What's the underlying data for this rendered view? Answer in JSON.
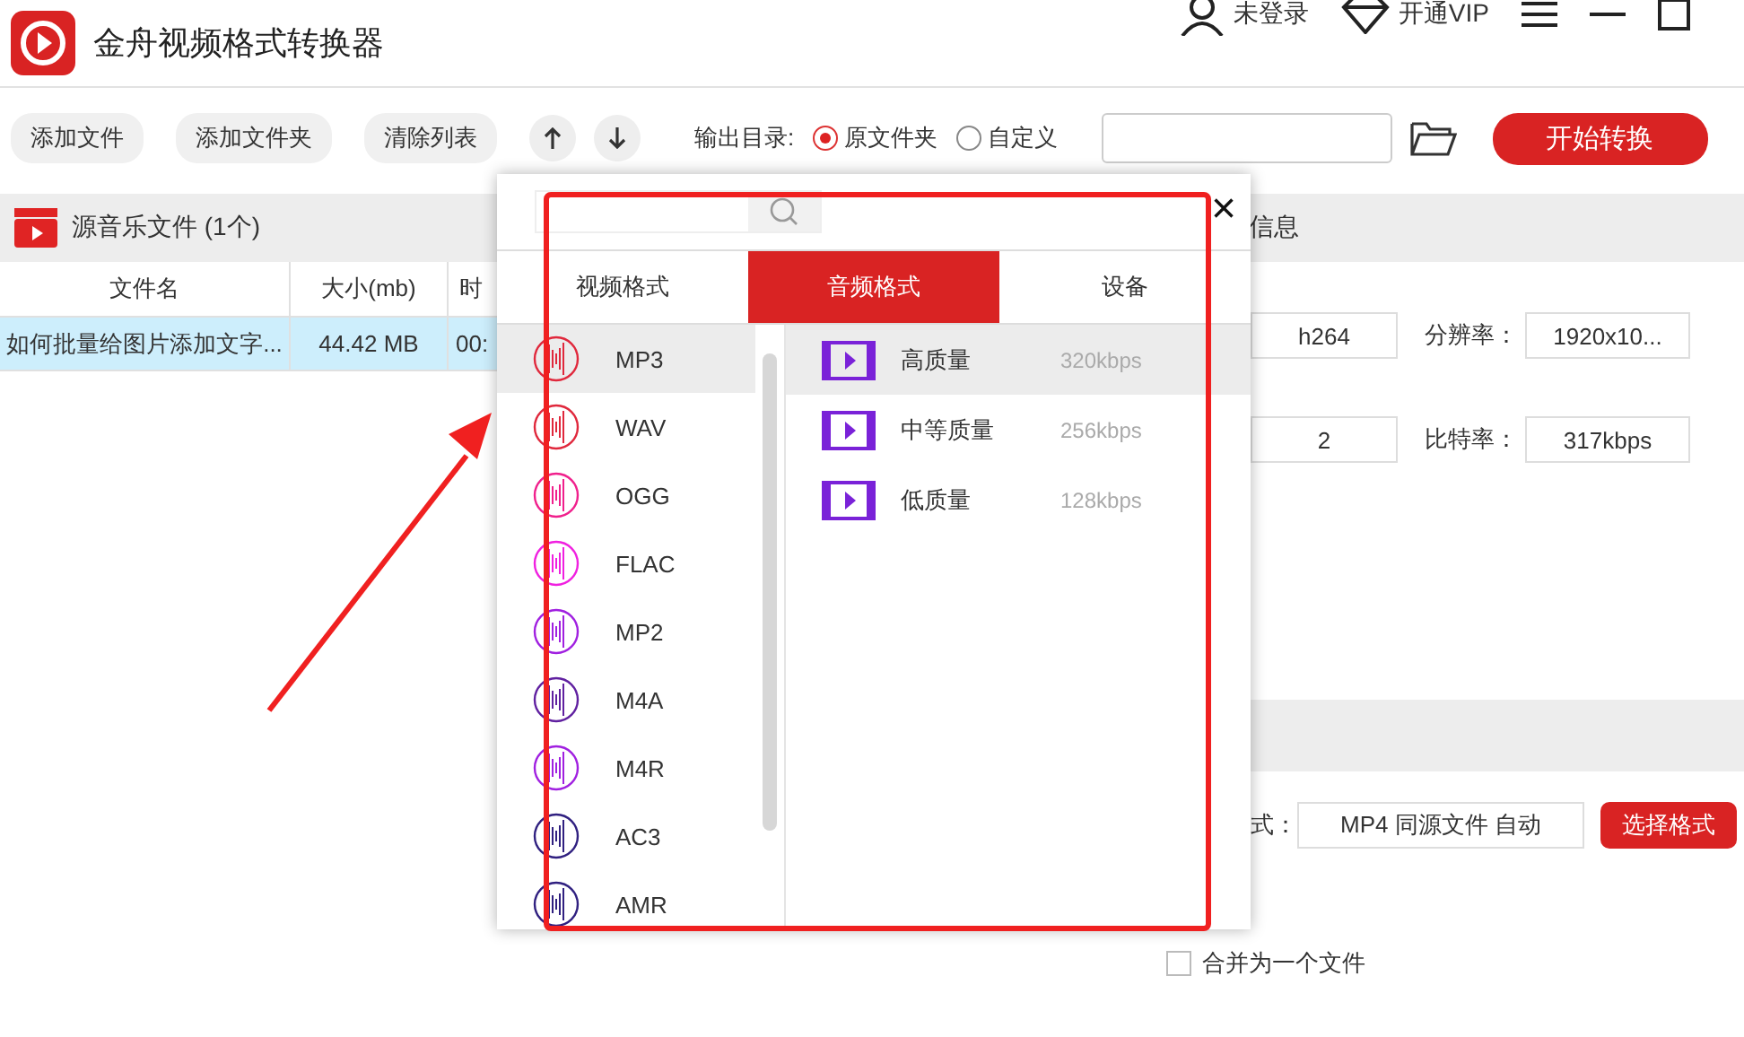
{
  "window": {
    "title": "金舟视频格式转换器",
    "user": "未登录",
    "vip": "开通VIP"
  },
  "toolbar": {
    "buttons": [
      "添加文件",
      "添加文件夹",
      "清除列表"
    ],
    "output_label": "输出目录:",
    "options": [
      {
        "label": "原文件夹",
        "selected": true
      },
      {
        "label": "自定义",
        "selected": false
      }
    ],
    "start": "开始转换"
  },
  "source": {
    "title": "源音乐文件 (1个)",
    "columns": [
      "文件名",
      "大小(mb)",
      "时"
    ],
    "rows": [
      {
        "cells": [
          "如何批量给图片添加文字...",
          "44.42 MB",
          "00:"
        ],
        "selected": true
      }
    ]
  },
  "info": {
    "title": "信息",
    "fields": [
      {
        "value": "h264",
        "label": "分辨率：",
        "value2": "1920x10..."
      },
      {
        "value": "2",
        "label": "比特率：",
        "value2": "317kbps"
      }
    ]
  },
  "output": {
    "label": "式：",
    "value": "MP4 同源文件 自动",
    "button": "选择格式",
    "merge": {
      "label": "合并为一个文件",
      "checked": false
    }
  },
  "popup": {
    "close": "×",
    "tabs": [
      {
        "label": "视频格式",
        "selected": false
      },
      {
        "label": "音频格式",
        "selected": true
      },
      {
        "label": "设备",
        "selected": false
      }
    ],
    "formats": [
      {
        "name": "MP3",
        "color": "#e0283c",
        "selected": true
      },
      {
        "name": "WAV",
        "color": "#e0283c",
        "selected": false
      },
      {
        "name": "OGG",
        "color": "#f0208c",
        "selected": false
      },
      {
        "name": "FLAC",
        "color": "#f020e0",
        "selected": false
      },
      {
        "name": "MP2",
        "color": "#a020e0",
        "selected": false
      },
      {
        "name": "M4A",
        "color": "#6020a0",
        "selected": false
      },
      {
        "name": "M4R",
        "color": "#a020e0",
        "selected": false
      },
      {
        "name": "AC3",
        "color": "#302080",
        "selected": false
      },
      {
        "name": "AMR",
        "color": "#302080",
        "selected": false
      }
    ],
    "qualities": [
      {
        "name": "高质量",
        "bitrate": "320kbps",
        "selected": true
      },
      {
        "name": "中等质量",
        "bitrate": "256kbps",
        "selected": false
      },
      {
        "name": "低质量",
        "bitrate": "128kbps",
        "selected": false
      }
    ]
  }
}
